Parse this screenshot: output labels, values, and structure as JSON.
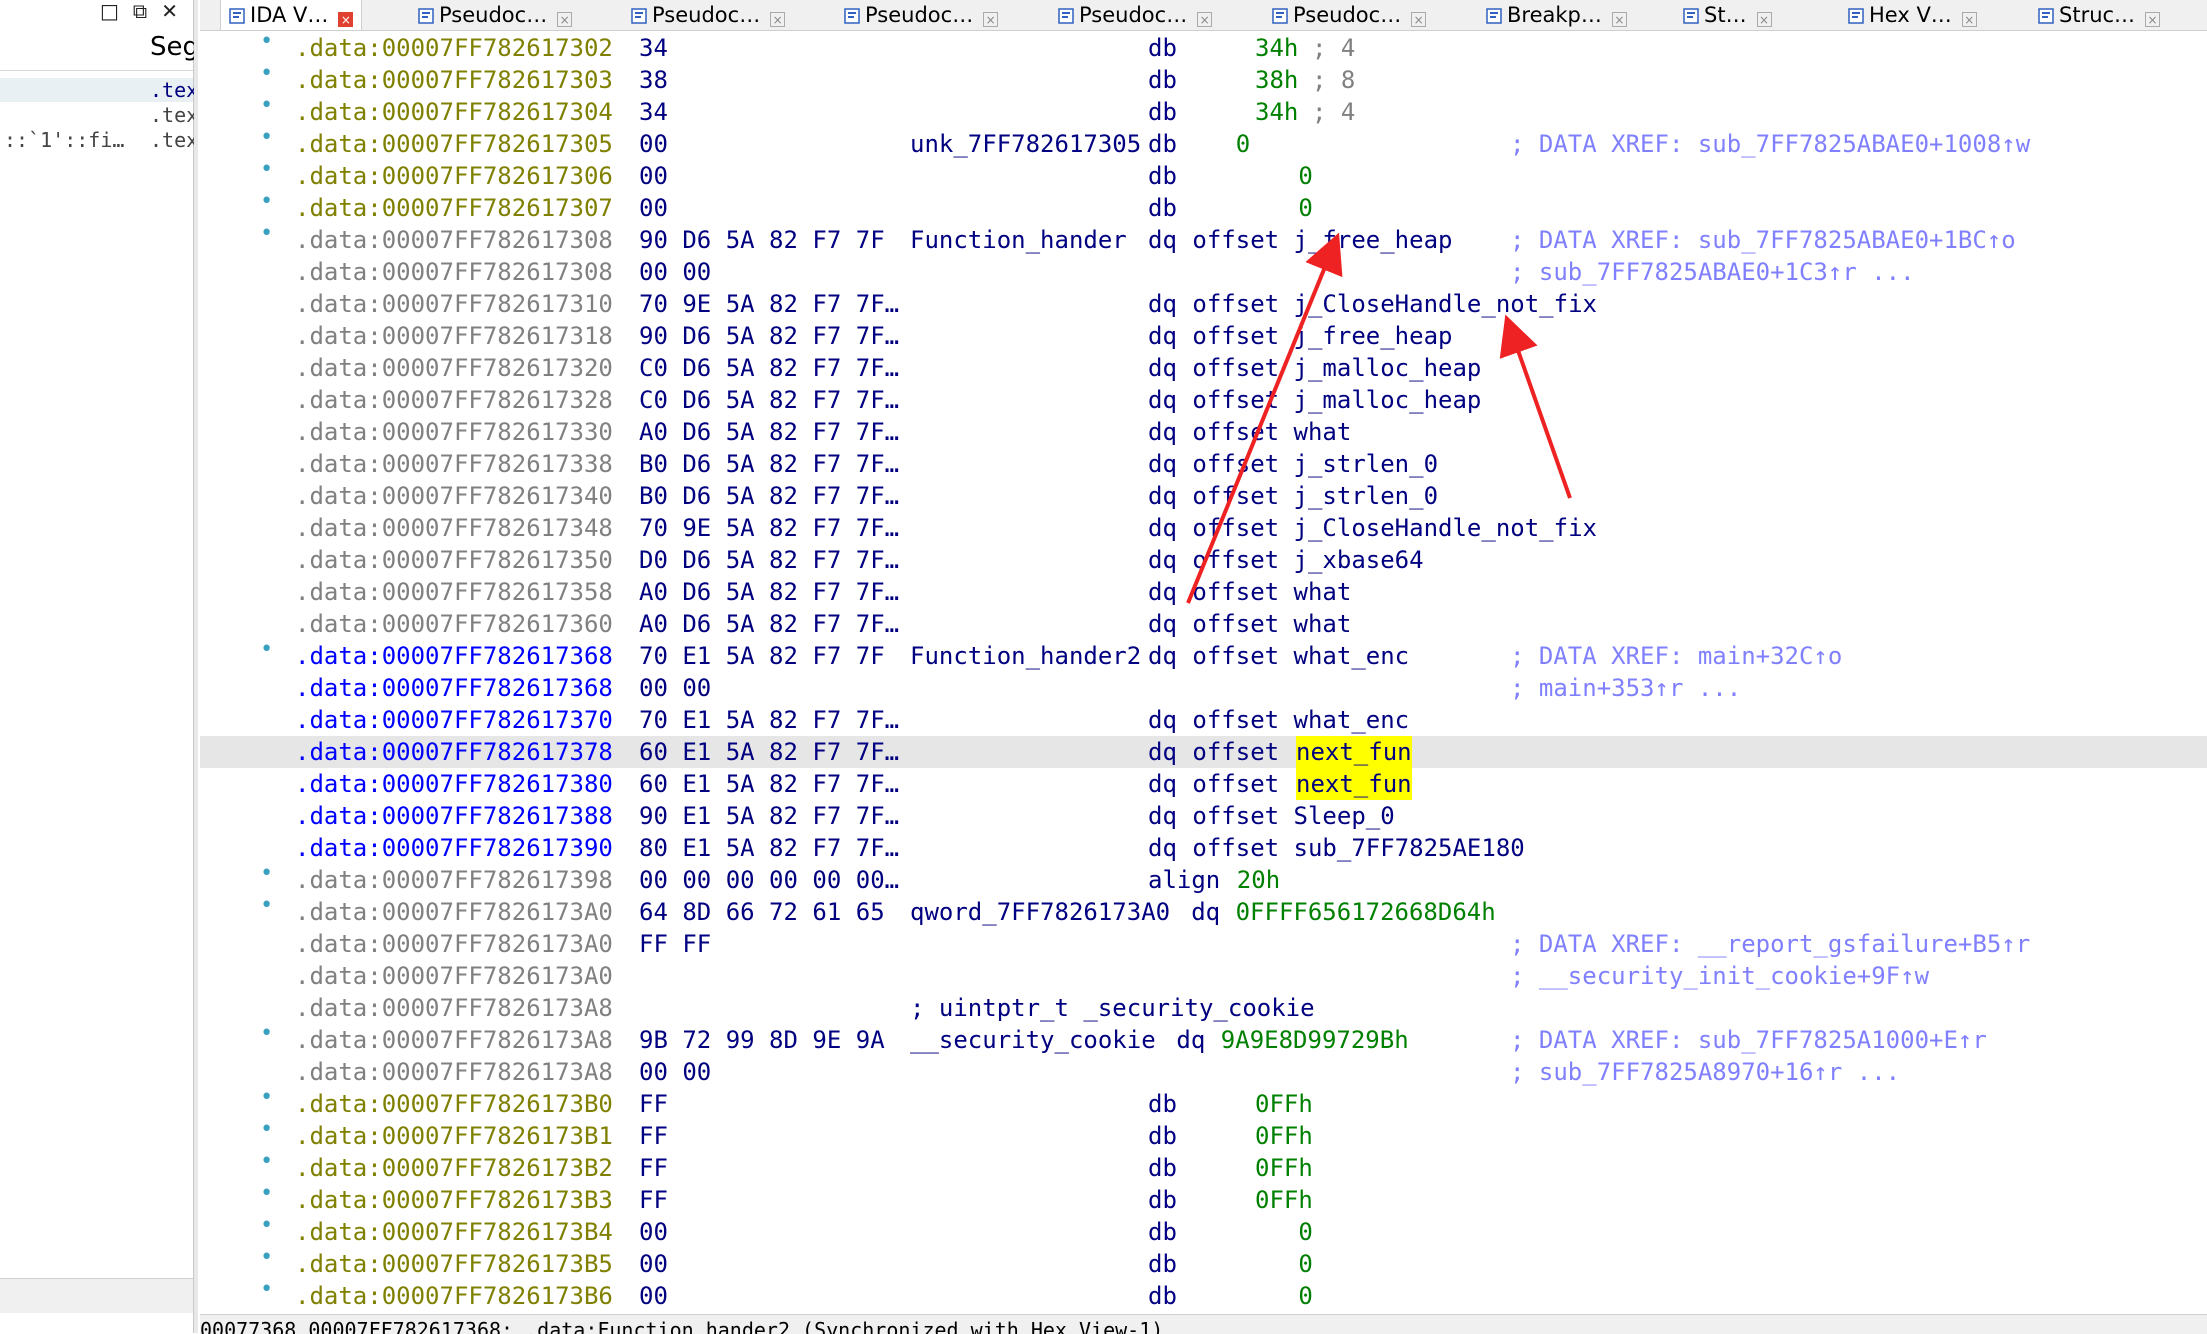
{
  "left_panel": {
    "window_controls": [
      "□",
      "⧉",
      "✕"
    ],
    "header": "Seg",
    "rows": [
      {
        "left": "",
        "right": ".tex"
      },
      {
        "left": "",
        "right": ".tex"
      },
      {
        "left": "::`1'::fi…",
        "right": ".tex"
      }
    ]
  },
  "tabs": [
    {
      "label": "IDA V…",
      "icon": "ida-view-icon",
      "active": true
    },
    {
      "label": "Pseudoc…",
      "icon": "pseudocode-icon",
      "active": false
    },
    {
      "label": "Pseudoc…",
      "icon": "pseudocode-icon",
      "active": false
    },
    {
      "label": "Pseudoc…",
      "icon": "pseudocode-icon",
      "active": false
    },
    {
      "label": "Pseudoc…",
      "icon": "pseudocode-icon",
      "active": false
    },
    {
      "label": "Pseudoc…",
      "icon": "pseudocode-icon",
      "active": false
    },
    {
      "label": "Breakp…",
      "icon": "breakpoints-icon",
      "active": false
    },
    {
      "label": "St…",
      "icon": "strings-icon",
      "active": false
    },
    {
      "label": "Hex V…",
      "icon": "hex-view-icon",
      "active": false
    },
    {
      "label": "Struc…",
      "icon": "structures-icon",
      "active": false
    }
  ],
  "rows": [
    {
      "dot": true,
      "addr": ".data:00007FF782617302",
      "ac": "c",
      "bytes": "34",
      "label": "",
      "ins": "db",
      "op": "34h",
      "opc": "num",
      "tail": "; 4",
      "tailc": "gcm",
      "xref": ""
    },
    {
      "dot": true,
      "addr": ".data:00007FF782617303",
      "ac": "c",
      "bytes": "38",
      "label": "",
      "ins": "db",
      "op": "38h",
      "opc": "num",
      "tail": "; 8",
      "tailc": "gcm",
      "xref": ""
    },
    {
      "dot": true,
      "addr": ".data:00007FF782617304",
      "ac": "c",
      "bytes": "34",
      "label": "",
      "ins": "db",
      "op": "34h",
      "opc": "num",
      "tail": "; 4",
      "tailc": "gcm",
      "xref": ""
    },
    {
      "dot": true,
      "addr": ".data:00007FF782617305",
      "ac": "c",
      "bytes": "00",
      "label": "unk_7FF782617305",
      "ins": "db",
      "op": "   0",
      "opc": "num",
      "tail": "",
      "tailc": "",
      "xref": "; DATA XREF: sub_7FF7825ABAE0+1008↑w"
    },
    {
      "dot": true,
      "addr": ".data:00007FF782617306",
      "ac": "c",
      "bytes": "00",
      "label": "",
      "ins": "db",
      "op": "   0",
      "opc": "num",
      "tail": "",
      "tailc": "",
      "xref": ""
    },
    {
      "dot": true,
      "addr": ".data:00007FF782617307",
      "ac": "c",
      "bytes": "00",
      "label": "",
      "ins": "db",
      "op": "   0",
      "opc": "num",
      "tail": "",
      "tailc": "",
      "xref": ""
    },
    {
      "dot": true,
      "addr": ".data:00007FF782617308",
      "ac": "g",
      "bytes": "90 D6 5A 82 F7 7F",
      "label": "Function_hander",
      "ins": "dq",
      "op": "offset j_free_heap",
      "opc": "lbl",
      "tail": "",
      "tailc": "",
      "xref": "; DATA XREF: sub_7FF7825ABAE0+1BC↑o"
    },
    {
      "dot": false,
      "addr": ".data:00007FF782617308",
      "ac": "g",
      "bytes": "00 00",
      "label": "",
      "ins": "",
      "op": "",
      "opc": "lbl",
      "tail": "",
      "tailc": "",
      "xref": "; sub_7FF7825ABAE0+1C3↑r ..."
    },
    {
      "dot": false,
      "addr": ".data:00007FF782617310",
      "ac": "g",
      "bytes": "70 9E 5A 82 F7 7F…",
      "label": "",
      "ins": "dq",
      "op": "offset j_CloseHandle_not_fix",
      "opc": "lbl",
      "tail": "",
      "tailc": "",
      "xref": ""
    },
    {
      "dot": false,
      "addr": ".data:00007FF782617318",
      "ac": "g",
      "bytes": "90 D6 5A 82 F7 7F…",
      "label": "",
      "ins": "dq",
      "op": "offset j_free_heap",
      "opc": "lbl",
      "tail": "",
      "tailc": "",
      "xref": ""
    },
    {
      "dot": false,
      "addr": ".data:00007FF782617320",
      "ac": "g",
      "bytes": "C0 D6 5A 82 F7 7F…",
      "label": "",
      "ins": "dq",
      "op": "offset j_malloc_heap",
      "opc": "lbl",
      "tail": "",
      "tailc": "",
      "xref": ""
    },
    {
      "dot": false,
      "addr": ".data:00007FF782617328",
      "ac": "g",
      "bytes": "C0 D6 5A 82 F7 7F…",
      "label": "",
      "ins": "dq",
      "op": "offset j_malloc_heap",
      "opc": "lbl",
      "tail": "",
      "tailc": "",
      "xref": ""
    },
    {
      "dot": false,
      "addr": ".data:00007FF782617330",
      "ac": "g",
      "bytes": "A0 D6 5A 82 F7 7F…",
      "label": "",
      "ins": "dq",
      "op": "offset what",
      "opc": "lbl",
      "tail": "",
      "tailc": "",
      "xref": ""
    },
    {
      "dot": false,
      "addr": ".data:00007FF782617338",
      "ac": "g",
      "bytes": "B0 D6 5A 82 F7 7F…",
      "label": "",
      "ins": "dq",
      "op": "offset j_strlen_0",
      "opc": "lbl",
      "tail": "",
      "tailc": "",
      "xref": ""
    },
    {
      "dot": false,
      "addr": ".data:00007FF782617340",
      "ac": "g",
      "bytes": "B0 D6 5A 82 F7 7F…",
      "label": "",
      "ins": "dq",
      "op": "offset j_strlen_0",
      "opc": "lbl",
      "tail": "",
      "tailc": "",
      "xref": ""
    },
    {
      "dot": false,
      "addr": ".data:00007FF782617348",
      "ac": "g",
      "bytes": "70 9E 5A 82 F7 7F…",
      "label": "",
      "ins": "dq",
      "op": "offset j_CloseHandle_not_fix",
      "opc": "lbl",
      "tail": "",
      "tailc": "",
      "xref": ""
    },
    {
      "dot": false,
      "addr": ".data:00007FF782617350",
      "ac": "g",
      "bytes": "D0 D6 5A 82 F7 7F…",
      "label": "",
      "ins": "dq",
      "op": "offset j_xbase64",
      "opc": "lbl",
      "tail": "",
      "tailc": "",
      "xref": ""
    },
    {
      "dot": false,
      "addr": ".data:00007FF782617358",
      "ac": "g",
      "bytes": "A0 D6 5A 82 F7 7F…",
      "label": "",
      "ins": "dq",
      "op": "offset what",
      "opc": "lbl",
      "tail": "",
      "tailc": "",
      "xref": ""
    },
    {
      "dot": false,
      "addr": ".data:00007FF782617360",
      "ac": "g",
      "bytes": "A0 D6 5A 82 F7 7F…",
      "label": "",
      "ins": "dq",
      "op": "offset what",
      "opc": "lbl",
      "tail": "",
      "tailc": "",
      "xref": ""
    },
    {
      "dot": true,
      "addr": ".data:00007FF782617368",
      "ac": "b",
      "bytes": "70 E1 5A 82 F7 7F",
      "label": "Function_hander2",
      "ins": "dq",
      "op": "offset what_enc",
      "opc": "lbl",
      "tail": "",
      "tailc": "",
      "xref": "; DATA XREF: main+32C↑o"
    },
    {
      "dot": false,
      "addr": ".data:00007FF782617368",
      "ac": "b",
      "bytes": "00 00",
      "label": "",
      "ins": "",
      "op": "",
      "opc": "lbl",
      "tail": "",
      "tailc": "",
      "xref": "; main+353↑r ..."
    },
    {
      "dot": false,
      "addr": ".data:00007FF782617370",
      "ac": "b",
      "bytes": "70 E1 5A 82 F7 7F…",
      "label": "",
      "ins": "dq",
      "op": "offset what_enc",
      "opc": "lbl",
      "tail": "",
      "tailc": "",
      "xref": ""
    },
    {
      "dot": false,
      "addr": ".data:00007FF782617378",
      "ac": "b",
      "bytes": "60 E1 5A 82 F7 7F…",
      "label": "",
      "ins": "dq",
      "op": "offset ",
      "opc": "lbl",
      "hlop": "next_fun",
      "tail": "",
      "tailc": "",
      "xref": "",
      "current": true
    },
    {
      "dot": false,
      "addr": ".data:00007FF782617380",
      "ac": "b",
      "bytes": "60 E1 5A 82 F7 7F…",
      "label": "",
      "ins": "dq",
      "op": "offset ",
      "opc": "lbl",
      "hlop": "next_fun",
      "tail": "",
      "tailc": "",
      "xref": ""
    },
    {
      "dot": false,
      "addr": ".data:00007FF782617388",
      "ac": "b",
      "bytes": "90 E1 5A 82 F7 7F…",
      "label": "",
      "ins": "dq",
      "op": "offset Sleep_0",
      "opc": "lbl",
      "tail": "",
      "tailc": "",
      "xref": ""
    },
    {
      "dot": false,
      "addr": ".data:00007FF782617390",
      "ac": "b",
      "bytes": "80 E1 5A 82 F7 7F…",
      "label": "",
      "ins": "dq",
      "op": "offset sub_7FF7825AE180",
      "opc": "lbl",
      "tail": "",
      "tailc": "",
      "xref": ""
    },
    {
      "dot": true,
      "addr": ".data:00007FF782617398",
      "ac": "g",
      "bytes": "00 00 00 00 00 00…",
      "label": "",
      "ins": "align",
      "op": "20h",
      "opc": "num",
      "tail": "",
      "tailc": "",
      "xref": ""
    },
    {
      "dot": true,
      "addr": ".data:00007FF7826173A0",
      "ac": "g",
      "bytes": "64 8D 66 72 61 65",
      "label": "qword_7FF7826173A0",
      "ins": "dq",
      "op": "0FFFF656172668D64h",
      "opc": "num",
      "tail": "",
      "tailc": "",
      "xref": ""
    },
    {
      "dot": false,
      "addr": ".data:00007FF7826173A0",
      "ac": "g",
      "bytes": "FF FF",
      "label": "",
      "ins": "",
      "op": "",
      "opc": "lbl",
      "tail": "",
      "tailc": "",
      "xref": "; DATA XREF: __report_gsfailure+B5↑r"
    },
    {
      "dot": false,
      "addr": ".data:00007FF7826173A0",
      "ac": "g",
      "bytes": "",
      "label": "",
      "ins": "",
      "op": "",
      "opc": "lbl",
      "tail": "",
      "tailc": "",
      "xref": "; __security_init_cookie+9F↑w"
    },
    {
      "dot": false,
      "addr": ".data:00007FF7826173A8",
      "ac": "g",
      "bytes": "",
      "label": "; uintptr_t _security_cookie",
      "ins": "",
      "op": "",
      "opc": "lbl",
      "tail": "",
      "tailc": "",
      "xref": ""
    },
    {
      "dot": true,
      "addr": ".data:00007FF7826173A8",
      "ac": "g",
      "bytes": "9B 72 99 8D 9E 9A",
      "label": "__security_cookie",
      "ins": "dq",
      "op": "9A9E8D99729Bh",
      "opc": "num",
      "tail": "",
      "tailc": "",
      "xref": "; DATA XREF: sub_7FF7825A1000+E↑r"
    },
    {
      "dot": false,
      "addr": ".data:00007FF7826173A8",
      "ac": "g",
      "bytes": "00 00",
      "label": "",
      "ins": "",
      "op": "",
      "opc": "lbl",
      "tail": "",
      "tailc": "",
      "xref": "; sub_7FF7825A8970+16↑r ..."
    },
    {
      "dot": true,
      "addr": ".data:00007FF7826173B0",
      "ac": "c",
      "bytes": "FF",
      "label": "",
      "ins": "db",
      "op": "0FFh",
      "opc": "num",
      "tail": "",
      "tailc": "",
      "xref": ""
    },
    {
      "dot": true,
      "addr": ".data:00007FF7826173B1",
      "ac": "c",
      "bytes": "FF",
      "label": "",
      "ins": "db",
      "op": "0FFh",
      "opc": "num",
      "tail": "",
      "tailc": "",
      "xref": ""
    },
    {
      "dot": true,
      "addr": ".data:00007FF7826173B2",
      "ac": "c",
      "bytes": "FF",
      "label": "",
      "ins": "db",
      "op": "0FFh",
      "opc": "num",
      "tail": "",
      "tailc": "",
      "xref": ""
    },
    {
      "dot": true,
      "addr": ".data:00007FF7826173B3",
      "ac": "c",
      "bytes": "FF",
      "label": "",
      "ins": "db",
      "op": "0FFh",
      "opc": "num",
      "tail": "",
      "tailc": "",
      "xref": ""
    },
    {
      "dot": true,
      "addr": ".data:00007FF7826173B4",
      "ac": "c",
      "bytes": "00",
      "label": "",
      "ins": "db",
      "op": "   0",
      "opc": "num",
      "tail": "",
      "tailc": "",
      "xref": ""
    },
    {
      "dot": true,
      "addr": ".data:00007FF7826173B5",
      "ac": "c",
      "bytes": "00",
      "label": "",
      "ins": "db",
      "op": "   0",
      "opc": "num",
      "tail": "",
      "tailc": "",
      "xref": ""
    },
    {
      "dot": true,
      "addr": ".data:00007FF7826173B6",
      "ac": "c",
      "bytes": "00",
      "label": "",
      "ins": "db",
      "op": "   0",
      "opc": "num",
      "tail": "",
      "tailc": "",
      "xref": ""
    }
  ],
  "status_bar": "00077368 00007FF782617368: .data:Function_hander2 (Synchronized with Hex View-1)",
  "colors": {
    "annotation_arrow": "#ee2222",
    "highlight": "#ffff00",
    "current_line": "#e6e6e6"
  }
}
